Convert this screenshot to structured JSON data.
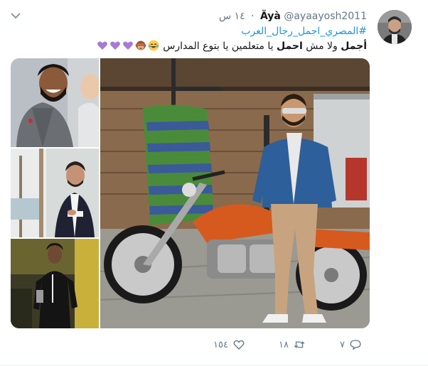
{
  "tweet": {
    "name": "Äyà",
    "handle": "@ayaayosh2011",
    "time": "١٤ س",
    "hashtag": "#المصري_اجمل_رجال_العرب",
    "text_part1": "أجمل",
    "text_part2": " ولا مش ",
    "text_part3": "احمل",
    "text_part4": " يا متعلمين يا بتوع المدارس ",
    "emojis": [
      "face-with-tears-of-joy",
      "see-no-evil-monkey",
      "purple-heart",
      "purple-heart",
      "purple-heart"
    ]
  },
  "actions": {
    "reply_count": "٧",
    "retweet_count": "١٨",
    "like_count": "١٥٤"
  },
  "colors": {
    "link": "#1b95e0",
    "muted": "#657786",
    "text": "#14171a",
    "purple_heart": "#a77bd5"
  }
}
